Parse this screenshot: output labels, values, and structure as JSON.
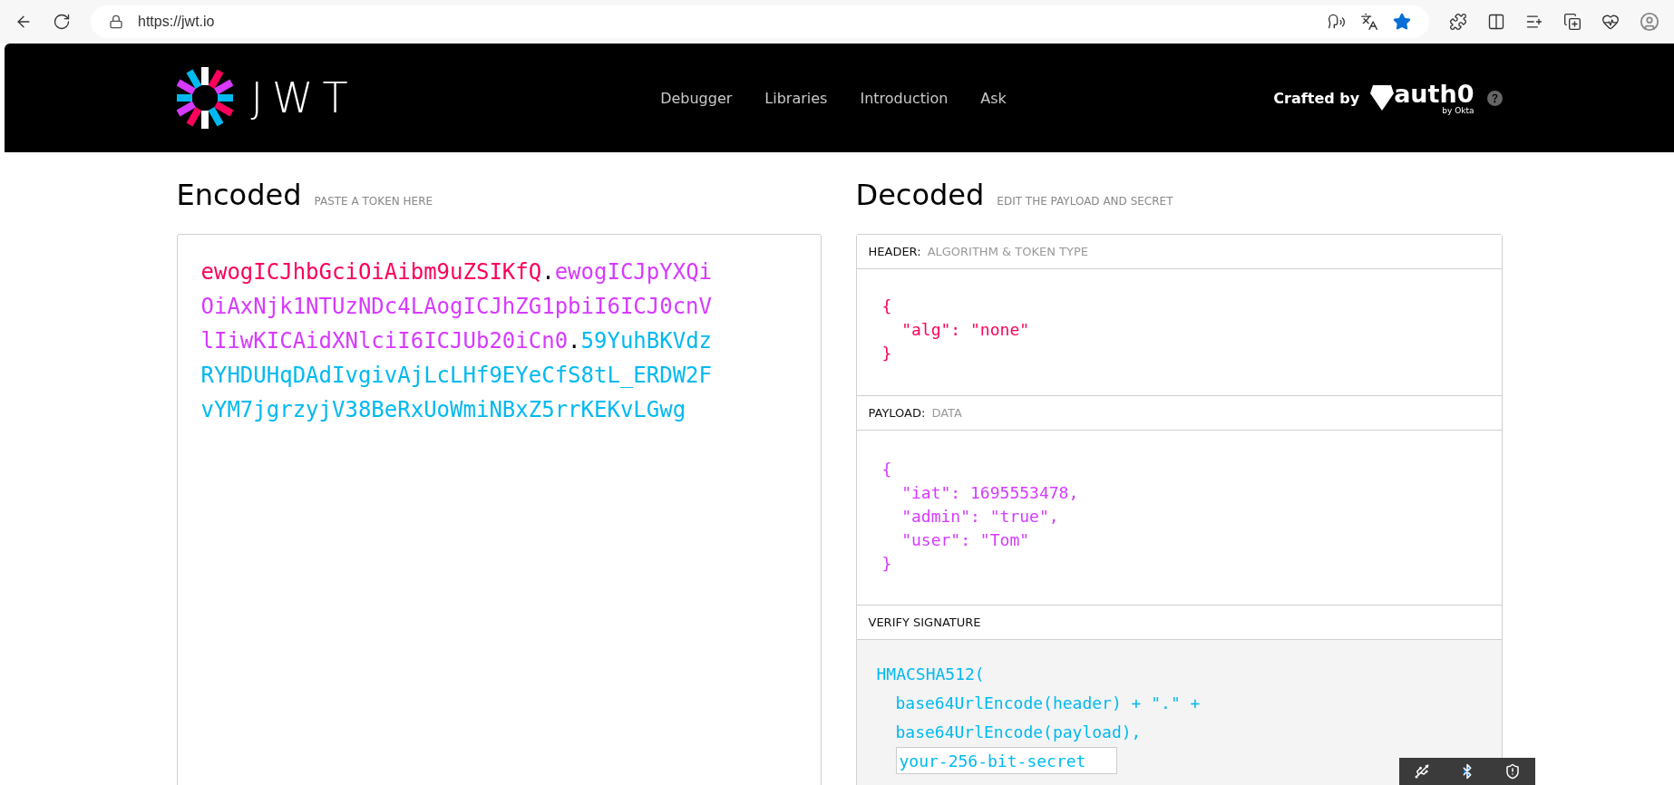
{
  "browser": {
    "url": "https://jwt.io"
  },
  "header": {
    "logo_text": "JWT",
    "nav": [
      {
        "label": "Debugger"
      },
      {
        "label": "Libraries"
      },
      {
        "label": "Introduction"
      },
      {
        "label": "Ask"
      }
    ],
    "crafted_by": "Crafted by",
    "brand": "auth0",
    "brand_sub": "by Okta"
  },
  "encoded": {
    "title": "Encoded",
    "hint": "PASTE A TOKEN HERE",
    "token": [
      {
        "kind": "header",
        "text": "ewogICJhbGciOiAibm9uZSIKfQ"
      },
      {
        "kind": "dot",
        "text": "."
      },
      {
        "kind": "payload",
        "text": "ewogICJpYXQiOiAxNjk1NTUzNDc4LAogICJhZG1pbiI6ICJ0cnVlIiwKICAidXNlciI6ICJUb20iCn0"
      },
      {
        "kind": "dot",
        "text": "."
      },
      {
        "kind": "signature",
        "text": "59YuhBKVdzRYHDUHqDAdIvgivAjLcLHf9EYeCfS8tL_ERDW2FvYM7jgrzyjV38BeRxUoWmiNBxZ5rrKEKvLGwg"
      }
    ]
  },
  "decoded": {
    "title": "Decoded",
    "hint": "EDIT THE PAYLOAD AND SECRET",
    "sections": [
      {
        "kind": "header",
        "label": "HEADER:",
        "sublabel": "ALGORITHM & TOKEN TYPE",
        "code": "{\n  \"alg\": \"none\"\n}"
      },
      {
        "kind": "payload",
        "label": "PAYLOAD:",
        "sublabel": "DATA",
        "code": "{\n  \"iat\": 1695553478,\n  \"admin\": \"true\",\n  \"user\": \"Tom\"\n}"
      }
    ],
    "verify": {
      "label": "VERIFY SIGNATURE",
      "lines": [
        "HMACSHA512(",
        "base64UrlEncode(header) + \".\" +",
        "base64UrlEncode(payload),"
      ],
      "secret": "your-256-bit-secret"
    }
  }
}
